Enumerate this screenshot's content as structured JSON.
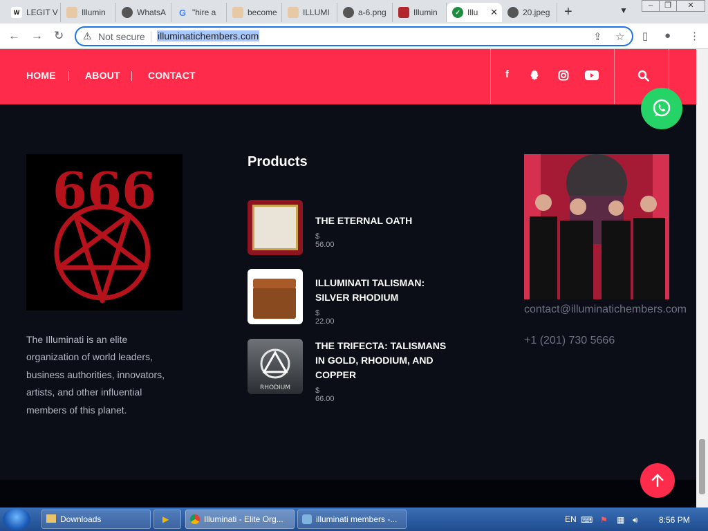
{
  "browser": {
    "tabs": [
      {
        "label": "LEGIT V",
        "icon": "wix-icon"
      },
      {
        "label": "Illumin",
        "icon": "site-icon"
      },
      {
        "label": "WhatsA",
        "icon": "globe-icon"
      },
      {
        "label": "\"hire a",
        "icon": "google-icon"
      },
      {
        "label": "become",
        "icon": "site-icon"
      },
      {
        "label": "ILLUMI",
        "icon": "site-icon"
      },
      {
        "label": "a-6.png",
        "icon": "globe-icon"
      },
      {
        "label": "Illumin",
        "icon": "site-icon"
      },
      {
        "label": "Illu",
        "icon": "check-icon"
      },
      {
        "label": "20.jpeg",
        "icon": "globe-icon"
      }
    ],
    "security_label": "Not secure",
    "url": "illuminatichembers.com"
  },
  "nav": {
    "links": [
      "HOME",
      "ABOUT",
      "CONTACT"
    ],
    "social": [
      "facebook-icon",
      "snapchat-icon",
      "instagram-icon",
      "youtube-icon"
    ]
  },
  "about": {
    "logo_text": "666",
    "text": "The Illuminati is an elite organization of world leaders, business authorities, innovators, artists, and other influential members of this planet."
  },
  "products": {
    "title": "Products",
    "items": [
      {
        "name": "THE ETERNAL OATH",
        "price": "$ 56.00"
      },
      {
        "name": "ILLUMINATI TALISMAN: SILVER RHODIUM",
        "price": "$ 22.00"
      },
      {
        "name": "THE TRIFECTA: TALISMANS IN GOLD, RHODIUM, AND COPPER",
        "price": "$ 66.00"
      }
    ],
    "rhodium_label": "RHODIUM"
  },
  "contact": {
    "email": "contact@illuminatichembers.com",
    "phone": "+1 (201) 730 5666"
  },
  "taskbar": {
    "items": [
      "Downloads",
      "Illuminati - Elite Org...",
      "illuminati members -..."
    ],
    "lang": "EN",
    "time": "8:56 PM"
  },
  "colors": {
    "accent": "#ff2b4a",
    "background": "#0b0d17",
    "whatsapp": "#25d366"
  }
}
